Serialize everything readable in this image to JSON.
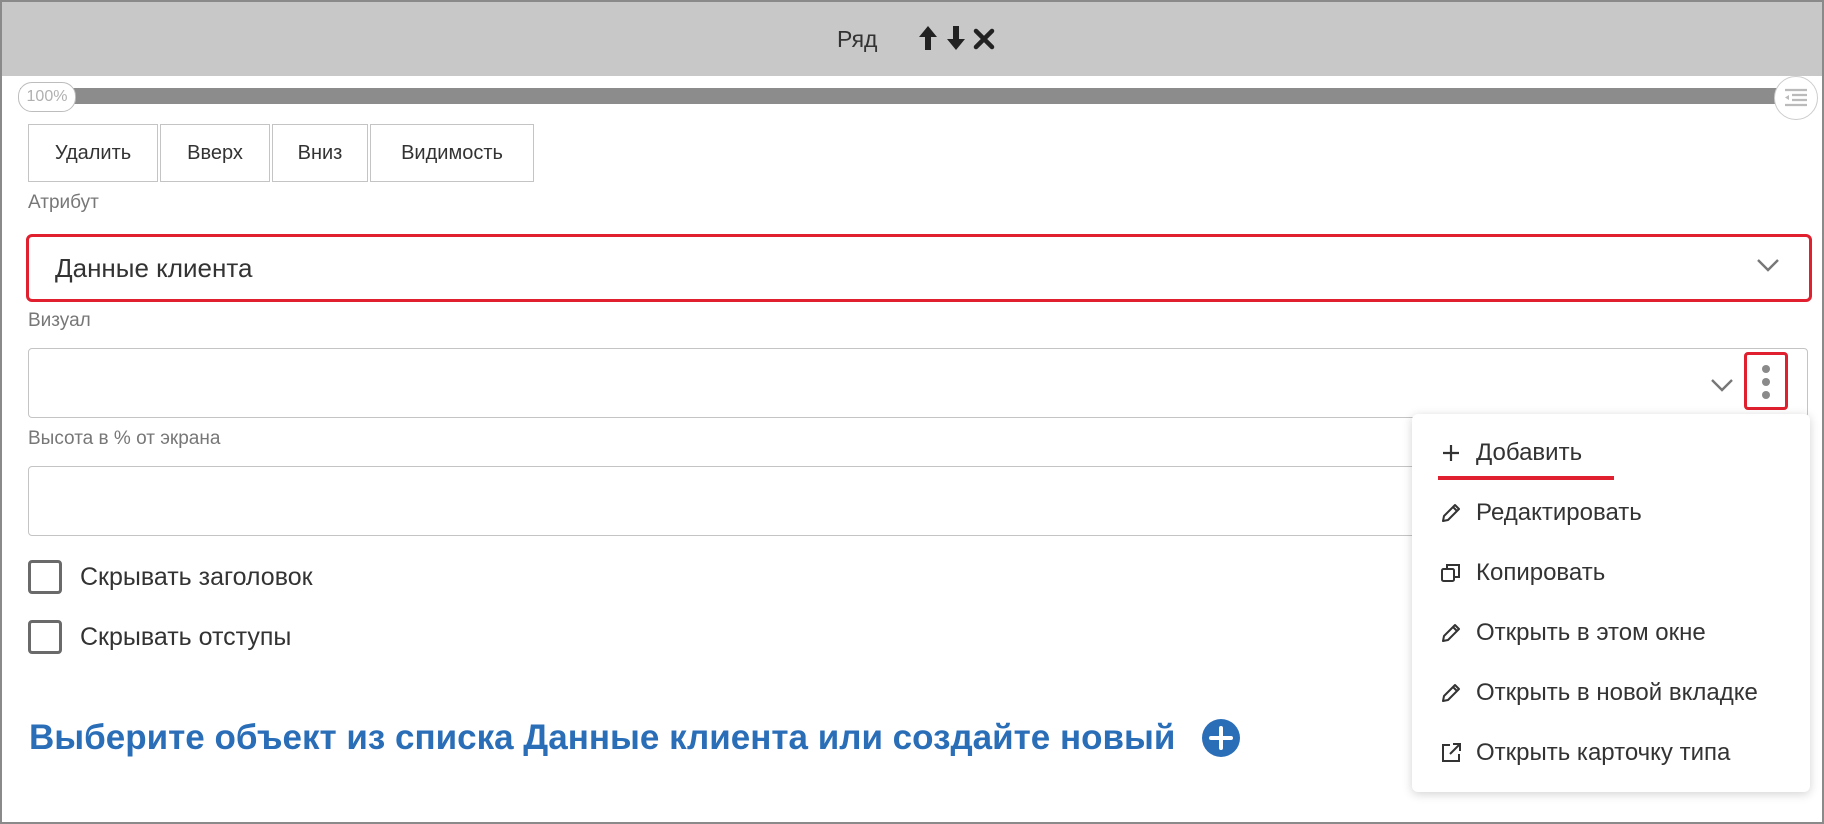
{
  "header": {
    "title": "Ряд",
    "icons": [
      "arrow-up-icon",
      "arrow-down-icon",
      "close-icon"
    ]
  },
  "progress": {
    "label": "100%",
    "value": 1.0
  },
  "toolbar": {
    "delete_label": "Удалить",
    "up_label": "Вверх",
    "down_label": "Вниз",
    "visibility_label": "Видимость"
  },
  "form": {
    "attribute_label": "Атрибут",
    "attribute_value": "Данные клиента",
    "visual_label": "Визуал",
    "visual_value": "",
    "height_label": "Высота в % от экрана",
    "height_value": "",
    "hide_title_label": "Скрывать заголовок",
    "hide_title_checked": false,
    "hide_padding_label": "Скрывать отступы",
    "hide_padding_checked": false
  },
  "prompt": {
    "text": "Выберите объект из списка Данные клиента или создайте новый"
  },
  "menu": {
    "items": [
      {
        "label": "Добавить",
        "icon": "plus-icon"
      },
      {
        "label": "Редактировать",
        "icon": "pencil-icon"
      },
      {
        "label": "Копировать",
        "icon": "copy-icon"
      },
      {
        "label": "Открыть в этом окне",
        "icon": "pencil-icon"
      },
      {
        "label": "Открыть в новой вкладке",
        "icon": "pencil-icon"
      },
      {
        "label": "Открыть карточку типа",
        "icon": "external-link-icon"
      }
    ]
  },
  "colors": {
    "highlight": "#e0202e",
    "link_blue": "#2a6eb8",
    "header_bg": "#c8c8c8"
  }
}
